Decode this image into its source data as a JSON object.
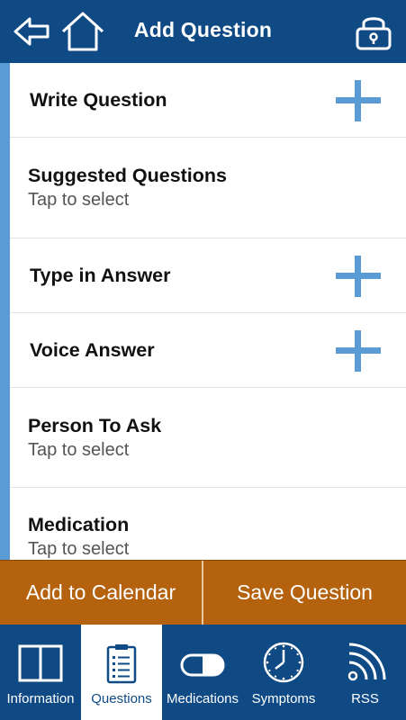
{
  "header": {
    "title": "Add Question",
    "icons": [
      "back-arrow-icon",
      "home-icon",
      "lock-icon"
    ]
  },
  "rows": [
    {
      "title": "Write Question",
      "action": "plus-icon"
    },
    {
      "title": "Suggested Questions",
      "subtitle": "Tap to select"
    },
    {
      "title": "Type in Answer",
      "action": "plus-icon"
    },
    {
      "title": "Voice Answer",
      "action": "plus-icon"
    },
    {
      "title": "Person To Ask",
      "subtitle": "Tap to select"
    },
    {
      "title": "Medication",
      "subtitle": "Tap to select"
    }
  ],
  "actions": {
    "add_to_calendar": "Add to Calendar",
    "save_question": "Save Question"
  },
  "tabs": [
    {
      "label": "Information",
      "icon": "book-icon",
      "active": false
    },
    {
      "label": "Questions",
      "icon": "clipboard-icon",
      "active": true
    },
    {
      "label": "Medications",
      "icon": "pill-icon",
      "active": false
    },
    {
      "label": "Symptoms",
      "icon": "clock-icon",
      "active": false
    },
    {
      "label": "RSS",
      "icon": "rss-icon",
      "active": false
    }
  ],
  "colors": {
    "header_bg": "#0f4a85",
    "accent_blue": "#5b9bd5",
    "action_orange": "#b5620f",
    "tab_active_bg": "#ffffff"
  }
}
